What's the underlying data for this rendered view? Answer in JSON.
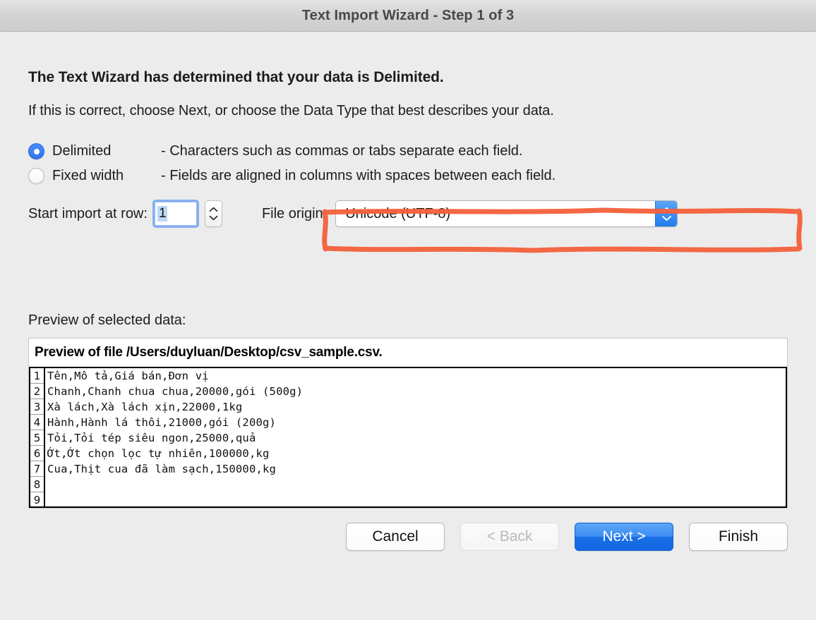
{
  "window": {
    "title": "Text Import Wizard - Step 1 of 3"
  },
  "content": {
    "headline": "The Text Wizard has determined that your data is Delimited.",
    "subline": "If this is correct, choose Next, or choose the Data Type that best describes your data."
  },
  "data_type": {
    "options": [
      {
        "label": "Delimited",
        "description": "- Characters such as commas or tabs separate each field.",
        "selected": true
      },
      {
        "label": "Fixed width",
        "description": "- Fields are aligned in columns with spaces between each field.",
        "selected": false
      }
    ]
  },
  "start_row": {
    "label": "Start import at row:",
    "value": "1"
  },
  "file_origin": {
    "label": "File origin:",
    "value": "Unicode (UTF-8)",
    "highlight_color": "#f4603c"
  },
  "preview": {
    "label": "Preview of selected data:",
    "header": "Preview of file /Users/duyluan/Desktop/csv_sample.csv.",
    "line_numbers": [
      "1",
      "2",
      "3",
      "4",
      "5",
      "6",
      "7",
      "8",
      "9"
    ],
    "lines": [
      "Tên,Mô tả,Giá bán,Đơn vị",
      "Chanh,Chanh chua chua,20000,gói (500g)",
      "Xà lách,Xà lách xịn,22000,1kg",
      "Hành,Hành lá thôi,21000,gói (200g)",
      "Tỏi,Tỏi tép siêu ngon,25000,quả",
      "Ớt,Ớt chọn lọc tự nhiên,100000,kg",
      "Cua,Thịt cua đã làm sạch,150000,kg",
      "",
      ""
    ]
  },
  "buttons": {
    "cancel": "Cancel",
    "back": "< Back",
    "next": "Next >",
    "finish": "Finish"
  },
  "colors": {
    "accent_blue": "#1f7cf0",
    "window_bg": "#ececec",
    "annotation_red": "#f4603c"
  }
}
